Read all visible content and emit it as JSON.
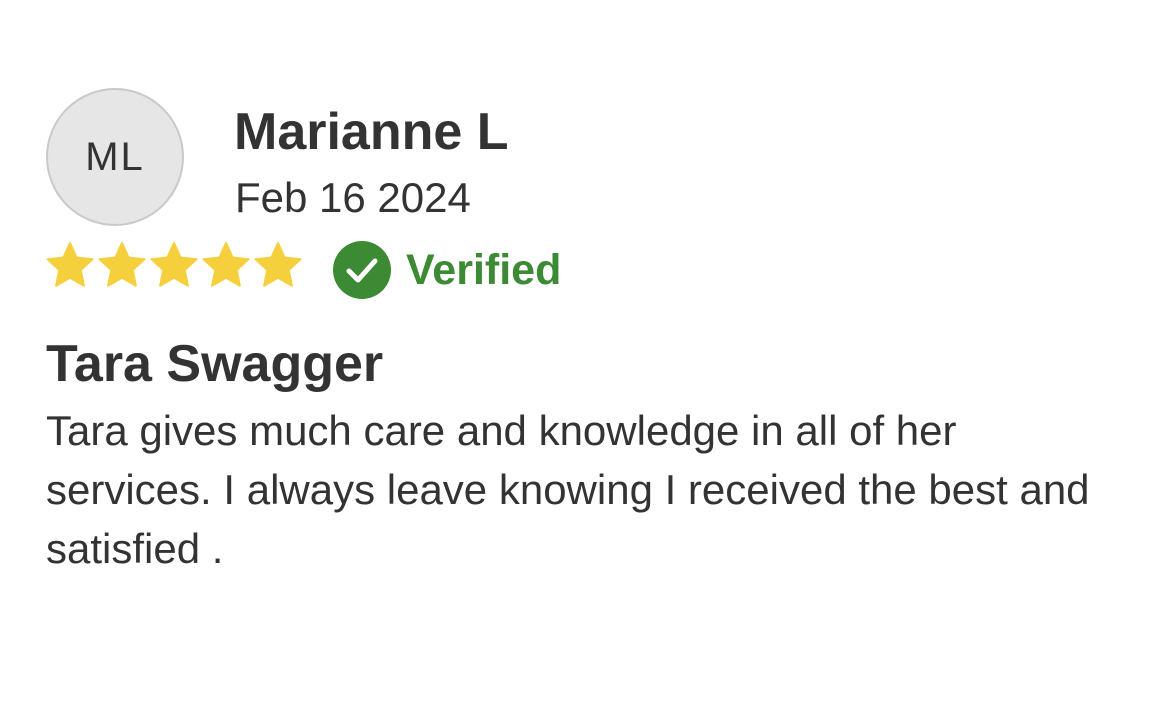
{
  "review": {
    "avatar_initials": "ML",
    "reviewer_name": "Marianne L",
    "date": "Feb 16 2024",
    "rating": 5,
    "rating_max": 5,
    "star_color": "#f6cf3c",
    "verified_label": "Verified",
    "verified_color": "#3d8a34",
    "title": "Tara Swagger",
    "body": "Tara gives much care and knowledge in all of her services. I always leave knowing I received the best and satisfied ."
  }
}
